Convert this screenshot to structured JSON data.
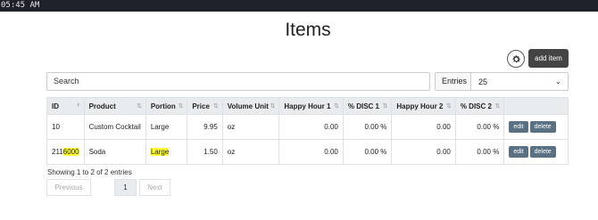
{
  "topbar": {
    "time": "05:45 AM"
  },
  "page": {
    "title": "Items"
  },
  "toolbar": {
    "add_label": "add item"
  },
  "search": {
    "placeholder": "Search"
  },
  "entries": {
    "label": "Entries",
    "value": "25"
  },
  "table": {
    "headers": [
      "ID",
      "Product",
      "Portion",
      "Price",
      "Volume Unit",
      "Happy Hour 1",
      "% DISC 1",
      "Happy Hour 2",
      "% DISC 2"
    ],
    "rows": [
      [
        "10",
        "Custom Cocktail",
        "Large",
        "9.95",
        "oz",
        "0.00",
        "0.00 %",
        "0.00",
        "0.00 %"
      ],
      [
        "2116000",
        "Soda",
        "Large",
        "1.50",
        "oz",
        "0.00",
        "0.00 %",
        "0.00",
        "0.00 %"
      ]
    ],
    "edit_label": "edit",
    "delete_label": "delete"
  },
  "footer": {
    "showing": "Showing 1 to 2 of 2 entries",
    "prev_label": "Previous",
    "page_label": "1",
    "next_label": "Next"
  }
}
